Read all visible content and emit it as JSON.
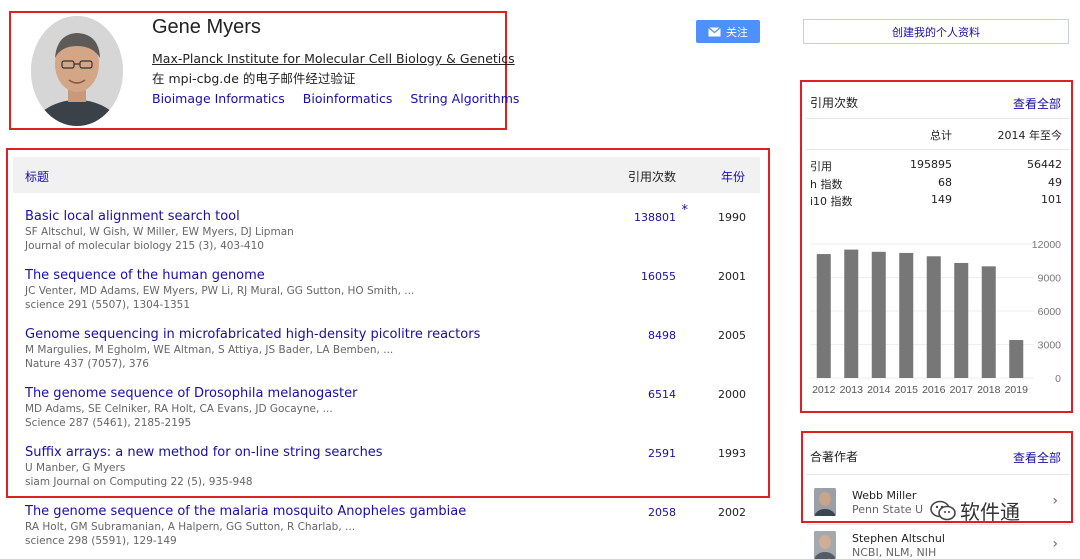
{
  "profile": {
    "name": "Gene Myers",
    "affiliation": "Max-Planck Institute for Molecular Cell Biology & Genetics",
    "email_verified": "在 mpi-cbg.de 的电子邮件经过验证",
    "interests": [
      "Bioimage Informatics",
      "Bioinformatics",
      "String Algorithms"
    ],
    "follow_label": "关注",
    "create_profile_label": "创建我的个人资料"
  },
  "articles": {
    "headers": {
      "title": "标题",
      "cited_by": "引用次数",
      "year": "年份"
    },
    "rows": [
      {
        "title": "Basic local alignment search tool",
        "authors": "SF Altschul, W Gish, W Miller, EW Myers, DJ Lipman",
        "journal": "Journal of molecular biology 215 (3), 403-410",
        "cited": "138801",
        "star": "*",
        "year": "1990"
      },
      {
        "title": "The sequence of the human genome",
        "authors": "JC Venter, MD Adams, EW Myers, PW Li, RJ Mural, GG Sutton, HO Smith, ...",
        "journal": "science 291 (5507), 1304-1351",
        "cited": "16055",
        "star": "",
        "year": "2001"
      },
      {
        "title": "Genome sequencing in microfabricated high-density picolitre reactors",
        "authors": "M Margulies, M Egholm, WE Altman, S Attiya, JS Bader, LA Bemben, ...",
        "journal": "Nature 437 (7057), 376",
        "cited": "8498",
        "star": "",
        "year": "2005"
      },
      {
        "title": "The genome sequence of Drosophila melanogaster",
        "authors": "MD Adams, SE Celniker, RA Holt, CA Evans, JD Gocayne, ...",
        "journal": "Science 287 (5461), 2185-2195",
        "cited": "6514",
        "star": "",
        "year": "2000"
      },
      {
        "title": "Suffix arrays: a new method for on-line string searches",
        "authors": "U Manber, G Myers",
        "journal": "siam Journal on Computing 22 (5), 935-948",
        "cited": "2591",
        "star": "",
        "year": "1993"
      },
      {
        "title": "The genome sequence of the malaria mosquito Anopheles gambiae",
        "authors": "RA Holt, GM Subramanian, A Halpern, GG Sutton, R Charlab, ...",
        "journal": "science 298 (5591), 129-149",
        "cited": "2058",
        "star": "",
        "year": "2002"
      }
    ]
  },
  "citations": {
    "title": "引用次数",
    "view_all": "查看全部",
    "col_total": "总计",
    "col_since": "2014 年至今",
    "metrics": [
      {
        "label": "引用",
        "total": "195895",
        "since": "56442"
      },
      {
        "label": "h 指数",
        "total": "68",
        "since": "49"
      },
      {
        "label": "i10 指数",
        "total": "149",
        "since": "101"
      }
    ]
  },
  "chart_data": {
    "type": "bar",
    "categories": [
      "2012",
      "2013",
      "2014",
      "2015",
      "2016",
      "2017",
      "2018",
      "2019"
    ],
    "values": [
      11100,
      11500,
      11300,
      11200,
      10900,
      10300,
      10000,
      3400
    ],
    "y_ticks": [
      "12000",
      "9000",
      "6000",
      "3000",
      "0"
    ],
    "ylim": [
      0,
      12000
    ],
    "bar_color": "#777777",
    "xlabel": "",
    "ylabel": ""
  },
  "coauthors": {
    "title": "合著作者",
    "view_all": "查看全部",
    "items": [
      {
        "name": "Webb Miller",
        "org": "Penn State U"
      },
      {
        "name": "Stephen Altschul",
        "org": "NCBI, NLM, NIH"
      }
    ]
  },
  "watermark": {
    "text": "软件通"
  },
  "colors": {
    "accent": "#1a0dab",
    "highlight_box": "#e02020",
    "follow_button": "#4d90fe"
  }
}
